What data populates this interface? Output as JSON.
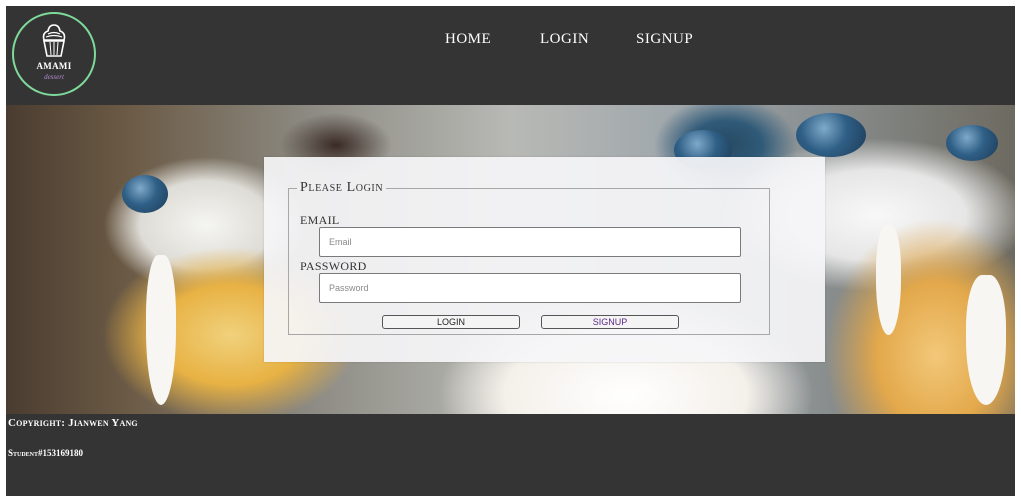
{
  "brand": {
    "name": "AMAMI",
    "tagline": "dessert",
    "accent_color": "#7fd99a",
    "tagline_color": "#b88bd8",
    "icon": "cupcake-icon"
  },
  "nav": {
    "items": [
      {
        "label": "HOME"
      },
      {
        "label": "LOGIN"
      },
      {
        "label": "SIGNUP"
      }
    ]
  },
  "login": {
    "legend": "Please Login",
    "email_label": "EMAIL",
    "email_placeholder": "Email",
    "email_value": "",
    "password_label": "PASSWORD",
    "password_placeholder": "Password",
    "password_value": "",
    "login_button": "LOGIN",
    "signup_button": "SIGNUP"
  },
  "footer": {
    "copyright": "Copyright: Jianwen Yang",
    "student": "Student#153169180"
  },
  "colors": {
    "header_bg": "#343434",
    "footer_bg": "#343434",
    "signup_text": "#5b2a86"
  }
}
